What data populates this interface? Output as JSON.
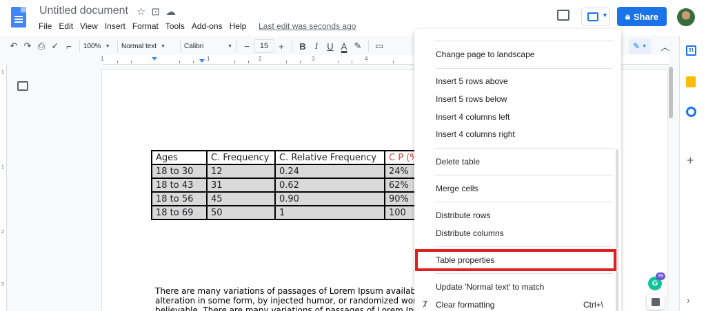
{
  "app": {
    "doc_title": "Untitled document",
    "last_edit": "Last edit was seconds ago",
    "menu": [
      "File",
      "Edit",
      "View",
      "Insert",
      "Format",
      "Tools",
      "Add-ons",
      "Help"
    ],
    "share_label": "Share"
  },
  "toolbar": {
    "zoom": "100%",
    "style": "Normal text",
    "font": "Calibri",
    "font_size": "15",
    "bold": "B",
    "italic": "I",
    "underline": "U",
    "text_color": "A"
  },
  "ruler": {
    "numbers": [
      "1",
      "1",
      "2",
      "3",
      "4"
    ],
    "vertical_numbers": [
      "1",
      "1",
      "2",
      "3"
    ]
  },
  "table": {
    "header": [
      "Ages",
      "C. Frequency",
      "C. Relative Frequency",
      "C P (%"
    ],
    "rows": [
      [
        "18 to 30",
        "12",
        "0.24",
        "24%"
      ],
      [
        "18 to 43",
        "31",
        "0.62",
        "62%"
      ],
      [
        "18 to 56",
        "45",
        "0.90",
        "90%"
      ],
      [
        "18 to 69",
        "50",
        "1",
        "100"
      ]
    ]
  },
  "body_text": [
    "There are many variations of passages of Lorem Ipsum available, but the",
    "alteration in some form, by injected humor, or randomized words which d",
    "believable. There are many variations of passages of Lorem Ipsum availab"
  ],
  "context_menu": {
    "items": [
      "Change page to landscape",
      "Insert 5 rows above",
      "Insert 5 rows below",
      "Insert 4 columns left",
      "Insert 4 columns right",
      "Delete table",
      "Merge cells",
      "Distribute rows",
      "Distribute columns",
      "Table properties",
      "Update 'Normal text' to match",
      "Clear formatting"
    ],
    "clear_formatting_shortcut": "Ctrl+\\"
  },
  "side_panel": {
    "calendar_label": "31",
    "grammarly_count": "39",
    "grammarly_letter": "G"
  },
  "colors": {
    "accent": "#1a73e8",
    "highlight": "#e0201f",
    "table_fill": "#d9d9d9",
    "header_red": "#e53935"
  }
}
